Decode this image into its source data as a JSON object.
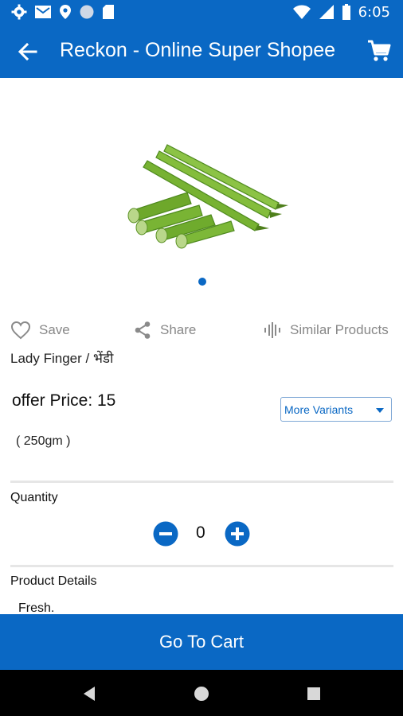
{
  "status_bar": {
    "time": "6:05",
    "left_icons": [
      "settings-icon",
      "gmail-icon",
      "location-icon",
      "circle-icon",
      "sd-card-icon"
    ],
    "right_icons": [
      "wifi-icon",
      "signal-icon",
      "battery-icon"
    ]
  },
  "app_bar": {
    "title": "Reckon - Online Super Shopee",
    "back_icon": "arrow-back-icon",
    "cart_icon": "shopping-cart-icon"
  },
  "gallery": {
    "image_subject": "okra / lady finger",
    "page_count": 1,
    "current_page": 1
  },
  "actions": {
    "save_label": "Save",
    "share_label": "Share",
    "similar_label": "Similar Products"
  },
  "product": {
    "name": "Lady Finger / भेंडी",
    "offer_price": "offer Price: 15",
    "weight": "( 250gm )",
    "variants_label": "More Variants"
  },
  "quantity": {
    "label": "Quantity",
    "value": "0"
  },
  "details": {
    "label": "Product Details",
    "description": "Fresh."
  },
  "footer": {
    "go_to_cart_label": "Go To Cart"
  },
  "colors": {
    "primary": "#0A68C4",
    "divider": "#e6e6e6",
    "muted_text": "#888888"
  }
}
